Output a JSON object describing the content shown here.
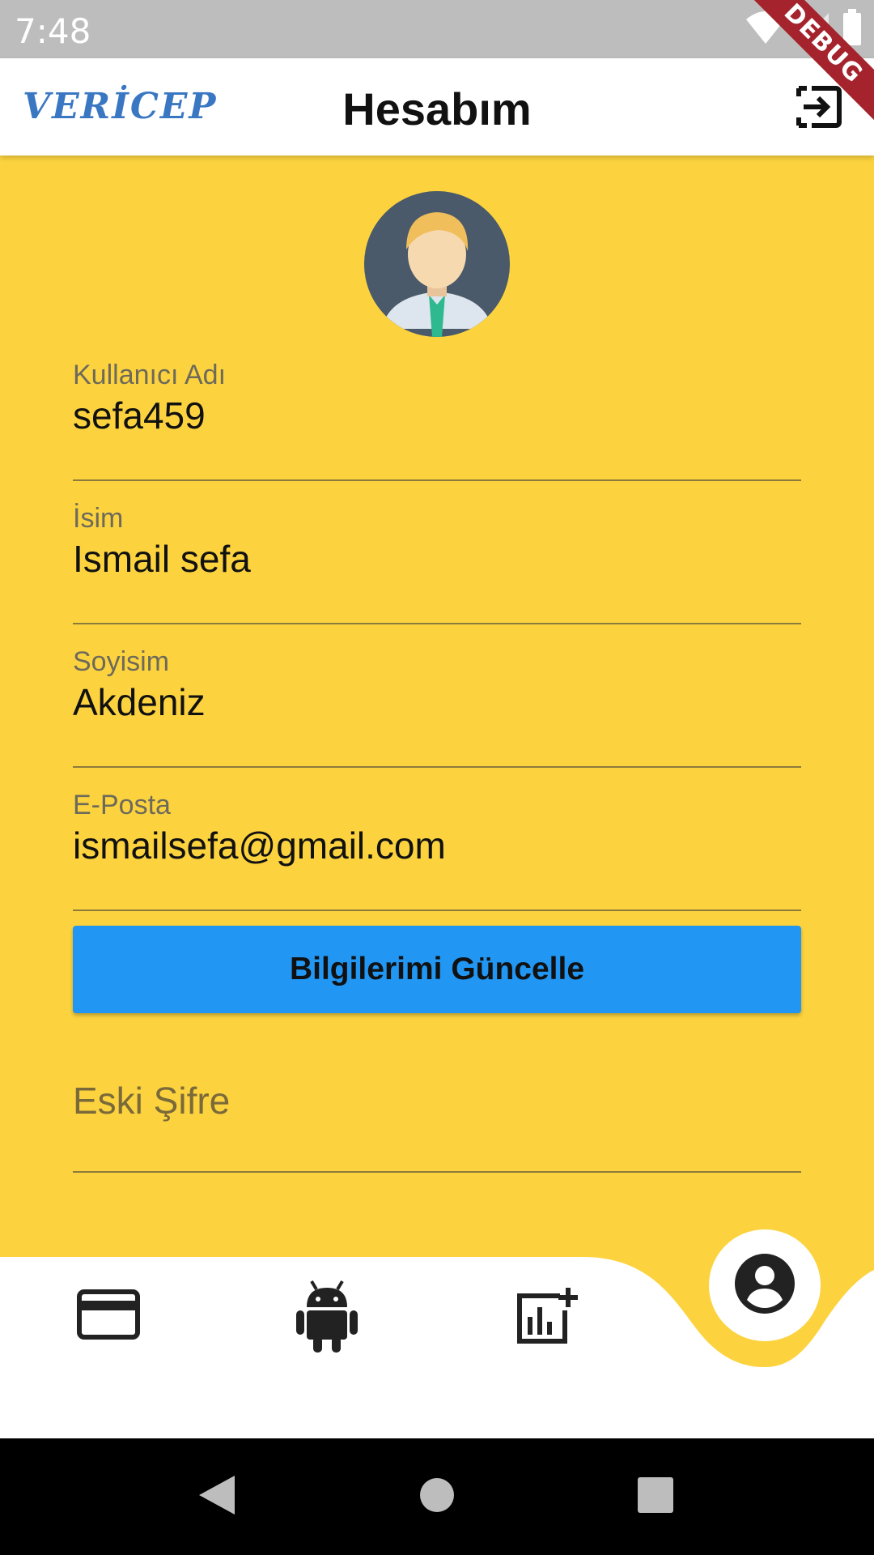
{
  "status_bar": {
    "time": "7:48"
  },
  "debug_banner": "DEBUG",
  "app_bar": {
    "logo": "VERİCEP",
    "title": "Hesabım"
  },
  "profile": {
    "fields": [
      {
        "label": "Kullanıcı Adı",
        "value": "sefa459"
      },
      {
        "label": "İsim",
        "value": "Ismail sefa"
      },
      {
        "label": "Soyisim",
        "value": "Akdeniz"
      },
      {
        "label": "E-Posta",
        "value": "ismailsefa@gmail.com"
      }
    ],
    "update_button": "Bilgilerimi Güncelle",
    "old_password_placeholder": "Eski Şifre"
  },
  "bottom_nav": {
    "items": [
      "credit-card-icon",
      "android-icon",
      "add-chart-icon",
      "account-circle-icon"
    ],
    "active": "account-circle-icon"
  },
  "colors": {
    "background": "#FCD33F",
    "button": "#2196F3",
    "logo": "#3A77C2",
    "debug": "#A4232C"
  }
}
